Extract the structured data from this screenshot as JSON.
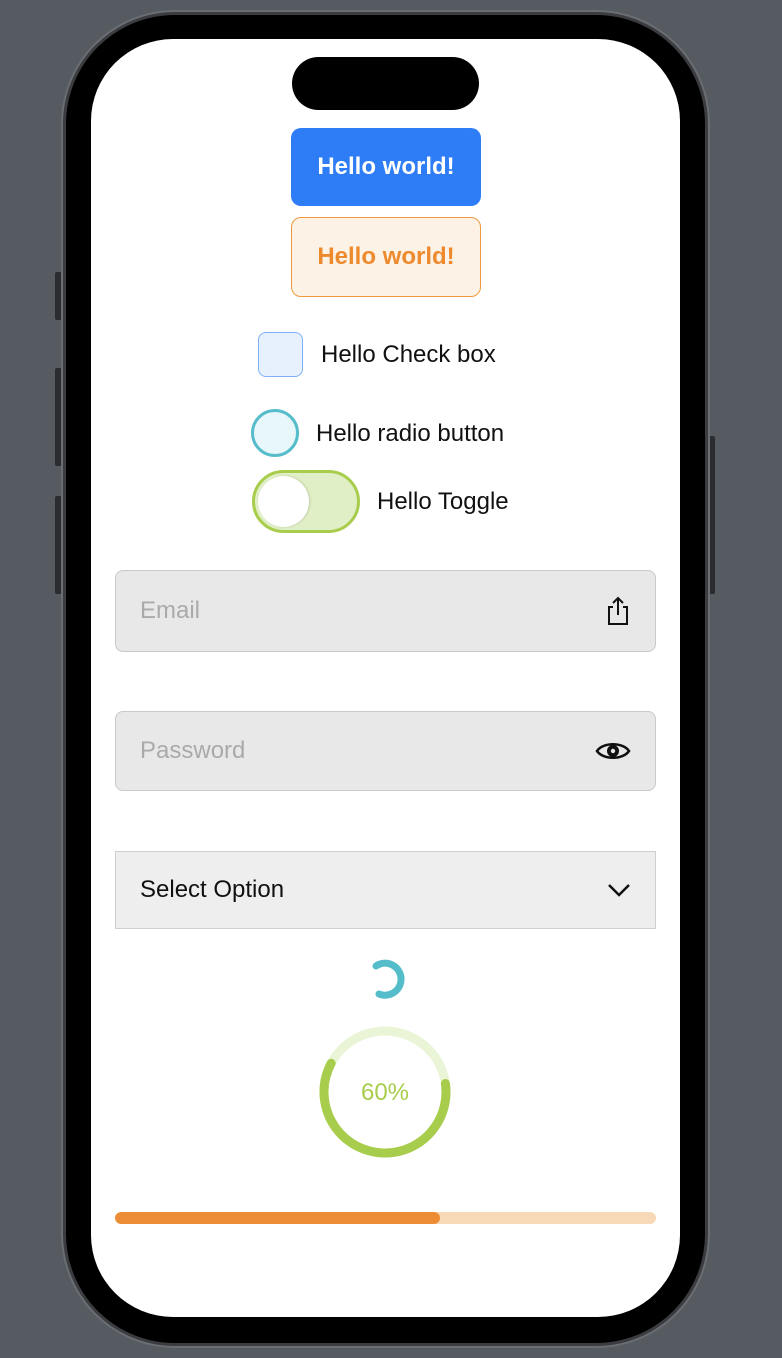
{
  "buttons": {
    "primary_label": "Hello world!",
    "secondary_label": "Hello world!"
  },
  "checkbox": {
    "label": "Hello Check box",
    "checked": false
  },
  "radio": {
    "label": "Hello radio button",
    "selected": false
  },
  "toggle": {
    "label": "Hello Toggle",
    "on": false
  },
  "email": {
    "placeholder": "Email",
    "value": "",
    "icon": "share-icon"
  },
  "password": {
    "placeholder": "Password",
    "value": "",
    "icon": "eye-icon"
  },
  "select": {
    "value": "Select Option",
    "icon": "chevron-down-icon"
  },
  "circular_progress": {
    "label": "60%",
    "value": 0.6,
    "color": "#a8cd4c"
  },
  "linear_progress": {
    "value": 0.6,
    "color": "#ec8c34"
  },
  "colors": {
    "primary": "#2f7df6",
    "orange": "#ee8a2e",
    "teal": "#55bdca",
    "green": "#a8cd4c"
  }
}
